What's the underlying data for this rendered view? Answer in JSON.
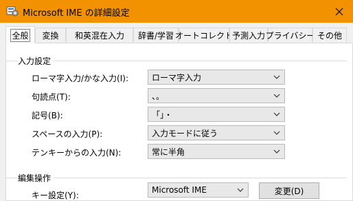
{
  "window": {
    "title": "Microsoft IME の詳細設定",
    "titlebar_color": "#f39200",
    "icons": {
      "app": "ime-settings-icon",
      "close": "close-icon"
    }
  },
  "tabs": [
    {
      "label": "全般",
      "active": true
    },
    {
      "label": "変換"
    },
    {
      "label": "和英混在入力"
    },
    {
      "label": "辞書/学習"
    },
    {
      "label": "オートコレクト"
    },
    {
      "label": "予測入力"
    },
    {
      "label": "プライバシー"
    },
    {
      "label": "その他"
    }
  ],
  "input_settings": {
    "title": "入力設定",
    "rows": [
      {
        "label": "ローマ字入力/かな入力(I):",
        "value": "ローマ字入力"
      },
      {
        "label": "句読点(T):",
        "value": "、。"
      },
      {
        "label": "記号(B):",
        "value": "「」・"
      },
      {
        "label": "スペースの入力(P):",
        "value": "入力モードに従う"
      },
      {
        "label": "テンキーからの入力(N):",
        "value": "常に半角"
      }
    ]
  },
  "edit_ops": {
    "title": "編集操作",
    "key_setting_label": "キー設定(Y):",
    "key_setting_value": "Microsoft IME",
    "change_button": "変更(D)"
  }
}
